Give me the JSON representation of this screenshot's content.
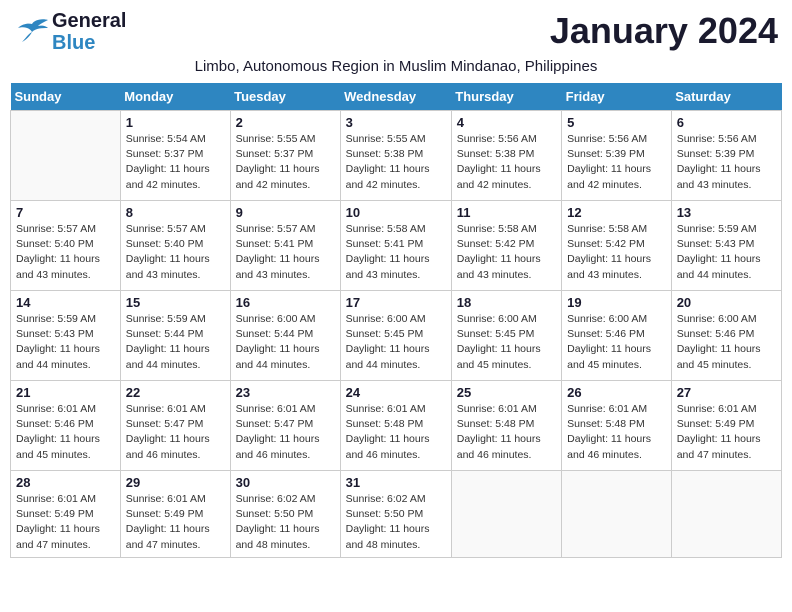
{
  "header": {
    "logo_line1": "General",
    "logo_line2": "Blue",
    "month_year": "January 2024",
    "location": "Limbo, Autonomous Region in Muslim Mindanao, Philippines"
  },
  "days_of_week": [
    "Sunday",
    "Monday",
    "Tuesday",
    "Wednesday",
    "Thursday",
    "Friday",
    "Saturday"
  ],
  "weeks": [
    [
      {
        "day": "",
        "info": ""
      },
      {
        "day": "1",
        "info": "Sunrise: 5:54 AM\nSunset: 5:37 PM\nDaylight: 11 hours\nand 42 minutes."
      },
      {
        "day": "2",
        "info": "Sunrise: 5:55 AM\nSunset: 5:37 PM\nDaylight: 11 hours\nand 42 minutes."
      },
      {
        "day": "3",
        "info": "Sunrise: 5:55 AM\nSunset: 5:38 PM\nDaylight: 11 hours\nand 42 minutes."
      },
      {
        "day": "4",
        "info": "Sunrise: 5:56 AM\nSunset: 5:38 PM\nDaylight: 11 hours\nand 42 minutes."
      },
      {
        "day": "5",
        "info": "Sunrise: 5:56 AM\nSunset: 5:39 PM\nDaylight: 11 hours\nand 42 minutes."
      },
      {
        "day": "6",
        "info": "Sunrise: 5:56 AM\nSunset: 5:39 PM\nDaylight: 11 hours\nand 43 minutes."
      }
    ],
    [
      {
        "day": "7",
        "info": "Sunrise: 5:57 AM\nSunset: 5:40 PM\nDaylight: 11 hours\nand 43 minutes."
      },
      {
        "day": "8",
        "info": "Sunrise: 5:57 AM\nSunset: 5:40 PM\nDaylight: 11 hours\nand 43 minutes."
      },
      {
        "day": "9",
        "info": "Sunrise: 5:57 AM\nSunset: 5:41 PM\nDaylight: 11 hours\nand 43 minutes."
      },
      {
        "day": "10",
        "info": "Sunrise: 5:58 AM\nSunset: 5:41 PM\nDaylight: 11 hours\nand 43 minutes."
      },
      {
        "day": "11",
        "info": "Sunrise: 5:58 AM\nSunset: 5:42 PM\nDaylight: 11 hours\nand 43 minutes."
      },
      {
        "day": "12",
        "info": "Sunrise: 5:58 AM\nSunset: 5:42 PM\nDaylight: 11 hours\nand 43 minutes."
      },
      {
        "day": "13",
        "info": "Sunrise: 5:59 AM\nSunset: 5:43 PM\nDaylight: 11 hours\nand 44 minutes."
      }
    ],
    [
      {
        "day": "14",
        "info": "Sunrise: 5:59 AM\nSunset: 5:43 PM\nDaylight: 11 hours\nand 44 minutes."
      },
      {
        "day": "15",
        "info": "Sunrise: 5:59 AM\nSunset: 5:44 PM\nDaylight: 11 hours\nand 44 minutes."
      },
      {
        "day": "16",
        "info": "Sunrise: 6:00 AM\nSunset: 5:44 PM\nDaylight: 11 hours\nand 44 minutes."
      },
      {
        "day": "17",
        "info": "Sunrise: 6:00 AM\nSunset: 5:45 PM\nDaylight: 11 hours\nand 44 minutes."
      },
      {
        "day": "18",
        "info": "Sunrise: 6:00 AM\nSunset: 5:45 PM\nDaylight: 11 hours\nand 45 minutes."
      },
      {
        "day": "19",
        "info": "Sunrise: 6:00 AM\nSunset: 5:46 PM\nDaylight: 11 hours\nand 45 minutes."
      },
      {
        "day": "20",
        "info": "Sunrise: 6:00 AM\nSunset: 5:46 PM\nDaylight: 11 hours\nand 45 minutes."
      }
    ],
    [
      {
        "day": "21",
        "info": "Sunrise: 6:01 AM\nSunset: 5:46 PM\nDaylight: 11 hours\nand 45 minutes."
      },
      {
        "day": "22",
        "info": "Sunrise: 6:01 AM\nSunset: 5:47 PM\nDaylight: 11 hours\nand 46 minutes."
      },
      {
        "day": "23",
        "info": "Sunrise: 6:01 AM\nSunset: 5:47 PM\nDaylight: 11 hours\nand 46 minutes."
      },
      {
        "day": "24",
        "info": "Sunrise: 6:01 AM\nSunset: 5:48 PM\nDaylight: 11 hours\nand 46 minutes."
      },
      {
        "day": "25",
        "info": "Sunrise: 6:01 AM\nSunset: 5:48 PM\nDaylight: 11 hours\nand 46 minutes."
      },
      {
        "day": "26",
        "info": "Sunrise: 6:01 AM\nSunset: 5:48 PM\nDaylight: 11 hours\nand 46 minutes."
      },
      {
        "day": "27",
        "info": "Sunrise: 6:01 AM\nSunset: 5:49 PM\nDaylight: 11 hours\nand 47 minutes."
      }
    ],
    [
      {
        "day": "28",
        "info": "Sunrise: 6:01 AM\nSunset: 5:49 PM\nDaylight: 11 hours\nand 47 minutes."
      },
      {
        "day": "29",
        "info": "Sunrise: 6:01 AM\nSunset: 5:49 PM\nDaylight: 11 hours\nand 47 minutes."
      },
      {
        "day": "30",
        "info": "Sunrise: 6:02 AM\nSunset: 5:50 PM\nDaylight: 11 hours\nand 48 minutes."
      },
      {
        "day": "31",
        "info": "Sunrise: 6:02 AM\nSunset: 5:50 PM\nDaylight: 11 hours\nand 48 minutes."
      },
      {
        "day": "",
        "info": ""
      },
      {
        "day": "",
        "info": ""
      },
      {
        "day": "",
        "info": ""
      }
    ]
  ]
}
